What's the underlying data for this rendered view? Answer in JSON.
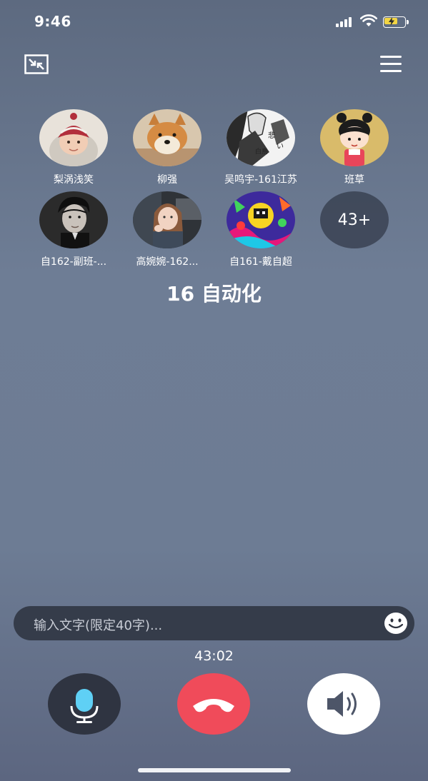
{
  "status_bar": {
    "time": "9:46"
  },
  "participants": [
    {
      "name": "梨涡浅笑",
      "avatar": "baby-avatar"
    },
    {
      "name": "柳强",
      "avatar": "dog-avatar"
    },
    {
      "name": "吴鸣宇-161江苏",
      "avatar": "manga-avatar"
    },
    {
      "name": "班草",
      "avatar": "cartoon-girl-avatar"
    },
    {
      "name": "自162-副班-...",
      "avatar": "man-portrait-avatar"
    },
    {
      "name": "高婉婉-162...",
      "avatar": "woman-avatar"
    },
    {
      "name": "自161-戴自超",
      "avatar": "colorful-art-avatar"
    }
  ],
  "more_count": "43+",
  "group_name": "16 自动化",
  "input": {
    "placeholder": "输入文字(限定40字)..."
  },
  "timer": "43:02",
  "colors": {
    "hangup": "#f04b5a",
    "mic_bg": "#2f3441",
    "speaker_bg": "#ffffff",
    "mic_icon": "#5fd0f5"
  }
}
